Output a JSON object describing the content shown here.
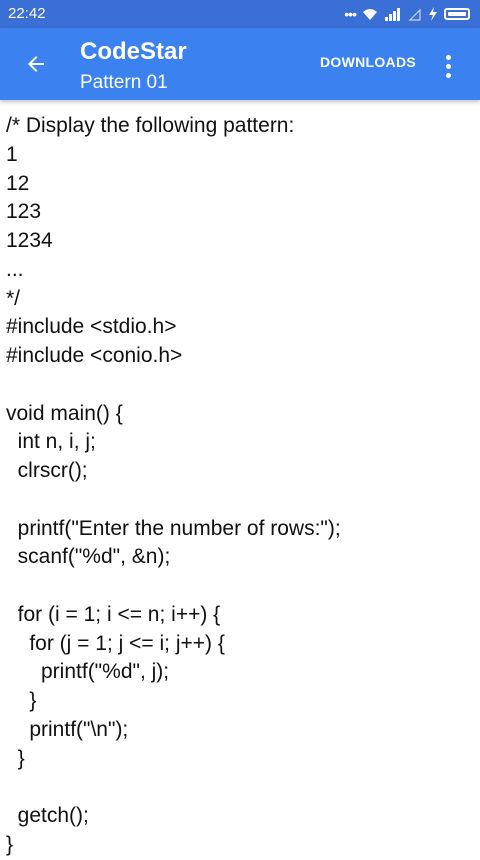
{
  "status_bar": {
    "time": "22:42",
    "icons": [
      "more-dots-icon",
      "wifi-icon",
      "signal-icon",
      "charging-icon",
      "battery-icon"
    ]
  },
  "app_bar": {
    "title": "CodeStar",
    "subtitle": "Pattern 01",
    "downloads_label": "DOWNLOADS"
  },
  "colors": {
    "status_bar": "#3a6fd6",
    "app_bar": "#3b82f0",
    "text": "#111111"
  },
  "code_lines": [
    "/* Display the following pattern:",
    "1",
    "12",
    "123",
    "1234",
    "...",
    "*/",
    "#include <stdio.h>",
    "#include <conio.h>",
    "",
    "void main() {",
    "  int n, i, j;",
    "  clrscr();",
    "",
    "  printf(\"Enter the number of rows:\");",
    "  scanf(\"%d\", &n);",
    "",
    "  for (i = 1; i <= n; i++) {",
    "    for (j = 1; j <= i; j++) {",
    "      printf(\"%d\", j);",
    "    }",
    "    printf(\"\\n\");",
    "  }",
    "",
    "  getch();",
    "}"
  ]
}
